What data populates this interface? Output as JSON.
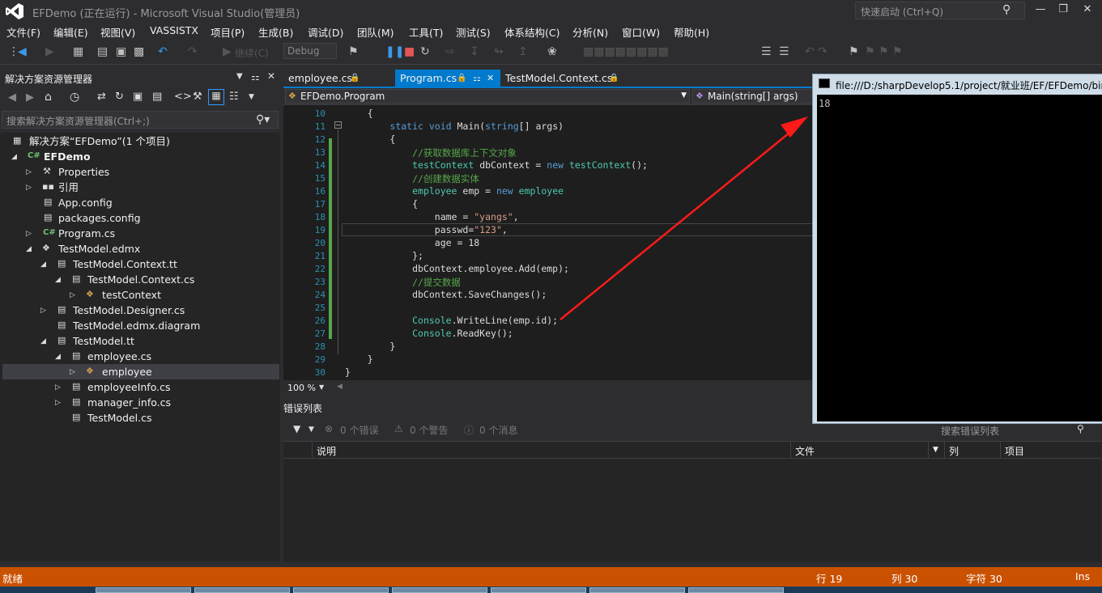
{
  "window": {
    "title": "EFDemo (正在运行) - Microsoft Visual Studio(管理员)",
    "quick_launch_placeholder": "快速启动 (Ctrl+Q)"
  },
  "menu": [
    "文件(F)",
    "编辑(E)",
    "视图(V)",
    "VASSISTX",
    "项目(P)",
    "生成(B)",
    "调试(D)",
    "团队(M)",
    "工具(T)",
    "测试(S)",
    "体系结构(C)",
    "分析(N)",
    "窗口(W)",
    "帮助(H)"
  ],
  "toolbar": {
    "continue_label": "继续(C)",
    "config_value": "Debug"
  },
  "solution_explorer": {
    "title": "解决方案资源管理器",
    "search_placeholder": "搜索解决方案资源管理器(Ctrl+;)",
    "nodes": [
      {
        "label": "解决方案“EFDemo”(1 个项目)"
      },
      {
        "label": "EFDemo"
      },
      {
        "label": "Properties"
      },
      {
        "label": "引用"
      },
      {
        "label": "App.config"
      },
      {
        "label": "packages.config"
      },
      {
        "label": "Program.cs"
      },
      {
        "label": "TestModel.edmx"
      },
      {
        "label": "TestModel.Context.tt"
      },
      {
        "label": "TestModel.Context.cs"
      },
      {
        "label": "testContext"
      },
      {
        "label": "TestModel.Designer.cs"
      },
      {
        "label": "TestModel.edmx.diagram"
      },
      {
        "label": "TestModel.tt"
      },
      {
        "label": "employee.cs"
      },
      {
        "label": "employee"
      },
      {
        "label": "employeeInfo.cs"
      },
      {
        "label": "manager_info.cs"
      },
      {
        "label": "TestModel.cs"
      }
    ]
  },
  "editor": {
    "tabs": [
      "employee.cs",
      "Program.cs",
      "TestModel.Context.cs"
    ],
    "nav_class": "EFDemo.Program",
    "nav_member": "Main(string[] args)",
    "line_numbers": [
      "10",
      "11",
      "12",
      "13",
      "14",
      "15",
      "16",
      "17",
      "18",
      "19",
      "20",
      "21",
      "22",
      "23",
      "24",
      "25",
      "26",
      "27",
      "28",
      "29",
      "30"
    ],
    "zoom": "100 %"
  },
  "error_list": {
    "title": "错误列表",
    "errors": "0 个错误",
    "warnings": "0 个警告",
    "messages": "0 个消息",
    "search_placeholder": "搜索错误列表",
    "columns": [
      "说明",
      "文件",
      "列",
      "项目"
    ]
  },
  "console": {
    "title": "file:///D:/sharpDevelop5.1/project/就业班/EF/EFDemo/bin",
    "output": "18"
  },
  "status": {
    "state": "就绪",
    "line": "行 19",
    "col": "列 30",
    "char": "字符 30",
    "mode": "Ins"
  }
}
